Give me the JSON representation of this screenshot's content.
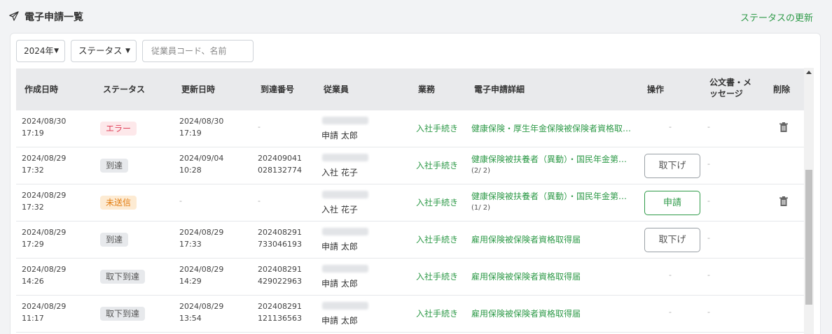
{
  "header": {
    "title": "電子申請一覧",
    "update_link": "ステータスの更新"
  },
  "filters": {
    "year": "2024年",
    "status": "ステータス",
    "search_placeholder": "従業員コード、名前"
  },
  "columns": {
    "created": "作成日時",
    "status": "ステータス",
    "updated": "更新日時",
    "arrival": "到達番号",
    "employee": "従業員",
    "task": "業務",
    "detail": "電子申請詳細",
    "action": "操作",
    "docs": "公文書・メッセージ",
    "delete": "削除"
  },
  "rows": [
    {
      "created_date": "2024/08/30",
      "created_time": "17:19",
      "status": "エラー",
      "status_type": "error",
      "updated_date": "2024/08/30",
      "updated_time": "17:19",
      "arrival_1": "-",
      "arrival_2": "",
      "employee_name": "申請 太郎",
      "task": "入社手続き",
      "detail": "健康保険・厚生年金保険被保険者資格取…",
      "detail_sub": "",
      "action": "-",
      "docs": "-",
      "deletable": true
    },
    {
      "created_date": "2024/08/29",
      "created_time": "17:32",
      "status": "到達",
      "status_type": "reach",
      "updated_date": "2024/09/04",
      "updated_time": "10:28",
      "arrival_1": "202409041",
      "arrival_2": "028132774",
      "employee_name": "入社 花子",
      "task": "入社手続き",
      "detail": "健康保険被扶養者（異動）・国民年金第…",
      "detail_sub": "(2/ 2)",
      "action": "取下げ",
      "docs": "-",
      "deletable": false
    },
    {
      "created_date": "2024/08/29",
      "created_time": "17:32",
      "status": "未送信",
      "status_type": "unsent",
      "updated_date": "-",
      "updated_time": "",
      "arrival_1": "-",
      "arrival_2": "",
      "employee_name": "入社 花子",
      "task": "入社手続き",
      "detail": "健康保険被扶養者（異動）・国民年金第…",
      "detail_sub": "(1/ 2)",
      "action": "申請",
      "docs": "-",
      "deletable": true
    },
    {
      "created_date": "2024/08/29",
      "created_time": "17:29",
      "status": "到達",
      "status_type": "reach",
      "updated_date": "2024/08/29",
      "updated_time": "17:33",
      "arrival_1": "202408291",
      "arrival_2": "733046193",
      "employee_name": "申請 太郎",
      "task": "入社手続き",
      "detail": "雇用保険被保険者資格取得届",
      "detail_sub": "",
      "action": "取下げ",
      "docs": "-",
      "deletable": false
    },
    {
      "created_date": "2024/08/29",
      "created_time": "14:26",
      "status": "取下到達",
      "status_type": "reach",
      "updated_date": "2024/08/29",
      "updated_time": "14:29",
      "arrival_1": "202408291",
      "arrival_2": "429022963",
      "employee_name": "申請 太郎",
      "task": "入社手続き",
      "detail": "雇用保険被保険者資格取得届",
      "detail_sub": "",
      "action": "-",
      "docs": "-",
      "deletable": false
    },
    {
      "created_date": "2024/08/29",
      "created_time": "11:17",
      "status": "取下到達",
      "status_type": "reach",
      "updated_date": "2024/08/29",
      "updated_time": "13:54",
      "arrival_1": "202408291",
      "arrival_2": "121136563",
      "employee_name": "申請 太郎",
      "task": "入社手続き",
      "detail": "雇用保険被保険者資格取得届",
      "detail_sub": "",
      "action": "-",
      "docs": "-",
      "deletable": false
    }
  ],
  "colors": {
    "accent": "#2e9a48",
    "error": "#e0425b",
    "unsent": "#e27d12"
  }
}
